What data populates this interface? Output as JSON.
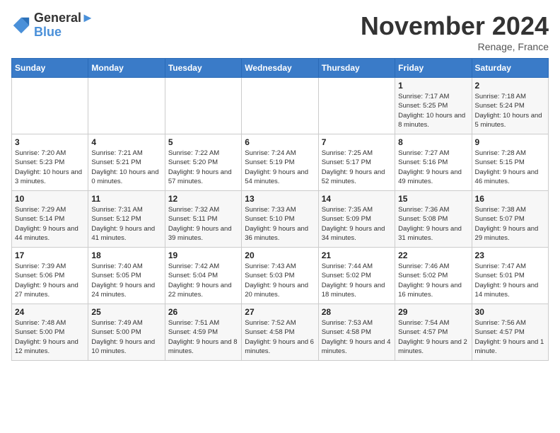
{
  "logo": {
    "line1": "General",
    "line2": "Blue"
  },
  "title": "November 2024",
  "subtitle": "Renage, France",
  "days_of_week": [
    "Sunday",
    "Monday",
    "Tuesday",
    "Wednesday",
    "Thursday",
    "Friday",
    "Saturday"
  ],
  "weeks": [
    [
      {
        "day": "",
        "info": ""
      },
      {
        "day": "",
        "info": ""
      },
      {
        "day": "",
        "info": ""
      },
      {
        "day": "",
        "info": ""
      },
      {
        "day": "",
        "info": ""
      },
      {
        "day": "1",
        "info": "Sunrise: 7:17 AM\nSunset: 5:25 PM\nDaylight: 10 hours and 8 minutes."
      },
      {
        "day": "2",
        "info": "Sunrise: 7:18 AM\nSunset: 5:24 PM\nDaylight: 10 hours and 5 minutes."
      }
    ],
    [
      {
        "day": "3",
        "info": "Sunrise: 7:20 AM\nSunset: 5:23 PM\nDaylight: 10 hours and 3 minutes."
      },
      {
        "day": "4",
        "info": "Sunrise: 7:21 AM\nSunset: 5:21 PM\nDaylight: 10 hours and 0 minutes."
      },
      {
        "day": "5",
        "info": "Sunrise: 7:22 AM\nSunset: 5:20 PM\nDaylight: 9 hours and 57 minutes."
      },
      {
        "day": "6",
        "info": "Sunrise: 7:24 AM\nSunset: 5:19 PM\nDaylight: 9 hours and 54 minutes."
      },
      {
        "day": "7",
        "info": "Sunrise: 7:25 AM\nSunset: 5:17 PM\nDaylight: 9 hours and 52 minutes."
      },
      {
        "day": "8",
        "info": "Sunrise: 7:27 AM\nSunset: 5:16 PM\nDaylight: 9 hours and 49 minutes."
      },
      {
        "day": "9",
        "info": "Sunrise: 7:28 AM\nSunset: 5:15 PM\nDaylight: 9 hours and 46 minutes."
      }
    ],
    [
      {
        "day": "10",
        "info": "Sunrise: 7:29 AM\nSunset: 5:14 PM\nDaylight: 9 hours and 44 minutes."
      },
      {
        "day": "11",
        "info": "Sunrise: 7:31 AM\nSunset: 5:12 PM\nDaylight: 9 hours and 41 minutes."
      },
      {
        "day": "12",
        "info": "Sunrise: 7:32 AM\nSunset: 5:11 PM\nDaylight: 9 hours and 39 minutes."
      },
      {
        "day": "13",
        "info": "Sunrise: 7:33 AM\nSunset: 5:10 PM\nDaylight: 9 hours and 36 minutes."
      },
      {
        "day": "14",
        "info": "Sunrise: 7:35 AM\nSunset: 5:09 PM\nDaylight: 9 hours and 34 minutes."
      },
      {
        "day": "15",
        "info": "Sunrise: 7:36 AM\nSunset: 5:08 PM\nDaylight: 9 hours and 31 minutes."
      },
      {
        "day": "16",
        "info": "Sunrise: 7:38 AM\nSunset: 5:07 PM\nDaylight: 9 hours and 29 minutes."
      }
    ],
    [
      {
        "day": "17",
        "info": "Sunrise: 7:39 AM\nSunset: 5:06 PM\nDaylight: 9 hours and 27 minutes."
      },
      {
        "day": "18",
        "info": "Sunrise: 7:40 AM\nSunset: 5:05 PM\nDaylight: 9 hours and 24 minutes."
      },
      {
        "day": "19",
        "info": "Sunrise: 7:42 AM\nSunset: 5:04 PM\nDaylight: 9 hours and 22 minutes."
      },
      {
        "day": "20",
        "info": "Sunrise: 7:43 AM\nSunset: 5:03 PM\nDaylight: 9 hours and 20 minutes."
      },
      {
        "day": "21",
        "info": "Sunrise: 7:44 AM\nSunset: 5:02 PM\nDaylight: 9 hours and 18 minutes."
      },
      {
        "day": "22",
        "info": "Sunrise: 7:46 AM\nSunset: 5:02 PM\nDaylight: 9 hours and 16 minutes."
      },
      {
        "day": "23",
        "info": "Sunrise: 7:47 AM\nSunset: 5:01 PM\nDaylight: 9 hours and 14 minutes."
      }
    ],
    [
      {
        "day": "24",
        "info": "Sunrise: 7:48 AM\nSunset: 5:00 PM\nDaylight: 9 hours and 12 minutes."
      },
      {
        "day": "25",
        "info": "Sunrise: 7:49 AM\nSunset: 5:00 PM\nDaylight: 9 hours and 10 minutes."
      },
      {
        "day": "26",
        "info": "Sunrise: 7:51 AM\nSunset: 4:59 PM\nDaylight: 9 hours and 8 minutes."
      },
      {
        "day": "27",
        "info": "Sunrise: 7:52 AM\nSunset: 4:58 PM\nDaylight: 9 hours and 6 minutes."
      },
      {
        "day": "28",
        "info": "Sunrise: 7:53 AM\nSunset: 4:58 PM\nDaylight: 9 hours and 4 minutes."
      },
      {
        "day": "29",
        "info": "Sunrise: 7:54 AM\nSunset: 4:57 PM\nDaylight: 9 hours and 2 minutes."
      },
      {
        "day": "30",
        "info": "Sunrise: 7:56 AM\nSunset: 4:57 PM\nDaylight: 9 hours and 1 minute."
      }
    ]
  ]
}
